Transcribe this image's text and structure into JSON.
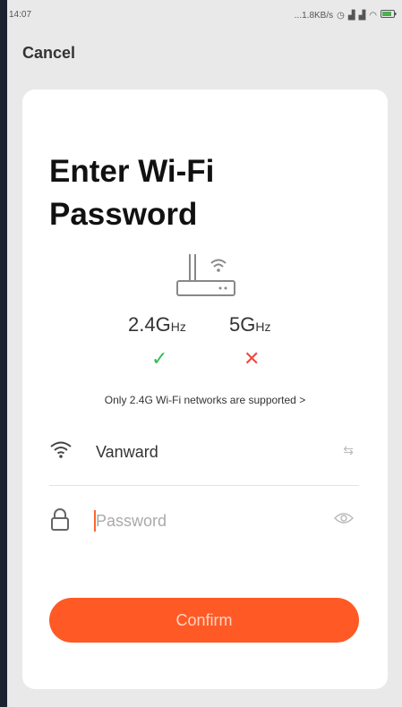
{
  "status": {
    "time": "14:07",
    "net_speed": "...1.8KB/s"
  },
  "header": {
    "cancel_label": "Cancel"
  },
  "card": {
    "title": "Enter Wi-Fi Password",
    "freq_24": "2.4G",
    "freq_24_unit": "Hz",
    "freq_5": "5G",
    "freq_5_unit": "Hz",
    "supported_mark": "✓",
    "unsupported_mark": "✕",
    "note": "Only 2.4G Wi-Fi networks are supported >"
  },
  "form": {
    "ssid_value": "Vanward",
    "password_placeholder": "Password",
    "confirm_label": "Confirm"
  },
  "colors": {
    "accent": "#ff5a25",
    "ok": "#2fbf57",
    "error": "#ef4b3d"
  },
  "icons": [
    "wifi-icon",
    "switch-network-icon",
    "lock-icon",
    "eye-icon",
    "router-icon",
    "signal-icon",
    "battery-icon"
  ]
}
